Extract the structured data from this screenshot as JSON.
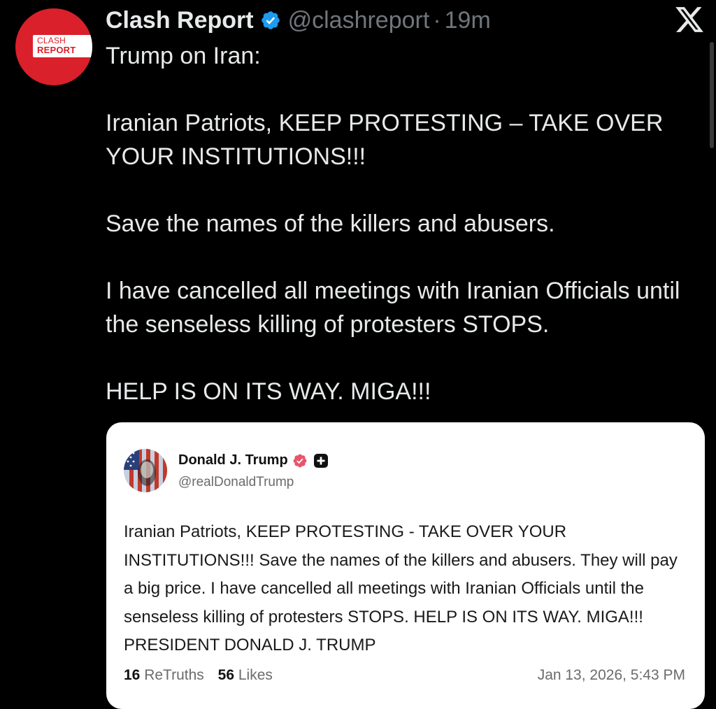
{
  "author": {
    "avatar_line1": "CLASH",
    "avatar_line2": "REPORT",
    "display_name": "Clash Report",
    "handle": "@clashreport",
    "separator": "·",
    "time": "19m",
    "verified_icon": "verified-badge-icon",
    "avatar_color": "#d9202b"
  },
  "app": {
    "logo_icon": "x-logo-icon"
  },
  "tweet": {
    "paragraphs": [
      "Trump on Iran:",
      "Iranian Patriots, KEEP PROTESTING – TAKE OVER YOUR INSTITUTIONS!!!",
      "Save the names of the killers and abusers.",
      "I have cancelled all meetings with Iranian Officials until the senseless killing of protesters STOPS.",
      "HELP IS ON ITS WAY. MIGA!!!"
    ]
  },
  "quoted_post": {
    "display_name": "Donald J. Trump",
    "handle": "@realDonaldTrump",
    "text": "Iranian Patriots, KEEP PROTESTING - TAKE OVER YOUR INSTITUTIONS!!! Save the names of the killers and abusers. They will pay a big price. I have cancelled all meetings with Iranian Officials until the senseless killing of protesters STOPS. HELP IS ON ITS WAY. MIGA!!! PRESIDENT DONALD J. TRUMP",
    "retruths_count": "16",
    "retruths_label": "ReTruths",
    "likes_count": "56",
    "likes_label": "Likes",
    "timestamp": "Jan 13, 2026, 5:43 PM",
    "verified_color": "#e8556b"
  }
}
